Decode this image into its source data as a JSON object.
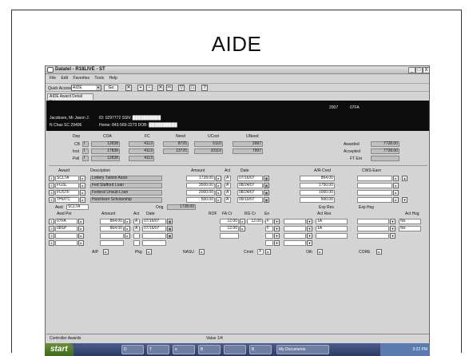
{
  "slide_title": "AIDE",
  "window": {
    "title": "Datatel - R18LIVE - ST",
    "controls": [
      "_",
      "□",
      "X"
    ]
  },
  "menu": [
    "File",
    "Edit",
    "Favorites",
    "Tools",
    "Help"
  ],
  "toolbar": {
    "quick_access_label": "Quick Access",
    "quick_access_value": "AIDE",
    "go_label": "Go"
  },
  "tab_label": "AIDE Award Detail Entry",
  "header": {
    "name": "Jacobsen, Mr Jason J.",
    "id": "ID: 0297772 SSN: ██████████",
    "location": "N Chas    SC   29406",
    "home": "Home: 843-569-2273  DOB: ██████████",
    "year": "2007",
    "term": "07FA"
  },
  "budget": {
    "headers": {
      "dep": "Dep",
      "coa": "COA",
      "fc": "FC",
      "need": "Need",
      "ucost": "UCost",
      "uneed": "UNeed"
    },
    "rows": [
      {
        "label": "CB",
        "flag": "I",
        "coa": "12838",
        "fc": "4113",
        "need": "8725",
        "ucost": "5110",
        "uneed": "2997"
      },
      {
        "label": "Inst",
        "flag": "I",
        "coa": "17838",
        "fc": "4113",
        "need": "13725",
        "ucost": "10110",
        "uneed": "7997"
      },
      {
        "label": "Pell",
        "flag": "I",
        "coa": "12838",
        "fc": "4113",
        "need": "",
        "ucost": "",
        "uneed": ""
      }
    ],
    "awarded_label": "Awarded",
    "awarded_value": "7728.00",
    "accepted_label": "Accepted",
    "accepted_value": "7728.00",
    "ftent_label": "FT Ent"
  },
  "awards": {
    "headers": {
      "award": "Award",
      "description": "Description",
      "amount": "Amount",
      "act": "Act",
      "date": "Date",
      "ar_cred": "A/R-Cred",
      "cws_earn": "CWS-Earn"
    },
    "rows": [
      {
        "num": "1",
        "code": "SCLTA",
        "description": "Lottery Tuition Assis",
        "amount": "1728.00",
        "act": "A",
        "date": "07/16/07",
        "ar_cred": "864.00"
      },
      {
        "num": "2",
        "code": "FGSL",
        "description": "Fed Stafford Loan",
        "amount": "3500.00",
        "act": "A",
        "date": "08/24/07",
        "ar_cred": "1750.00"
      },
      {
        "num": "3",
        "code": "FUSTF",
        "description": "Federal Unsub Loan",
        "amount": "2000.00",
        "act": "A",
        "date": "08/24/07",
        "ar_cred": "1000.00"
      },
      {
        "num": "4",
        "code": "THUTC",
        "description": "Hutchison Scholarship",
        "amount": "500.00",
        "act": "A",
        "date": "09/10/07",
        "ar_cred": "500.00"
      }
    ]
  },
  "award_detail": {
    "awd_label": "Awd",
    "awd_value": "SCLTA",
    "orig_label": "Orig",
    "orig_value": "1728.00",
    "headers": {
      "awd_per": "Awd Per",
      "amount": "Amount",
      "act": "Act",
      "date": "Date",
      "rof": "ROF",
      "fa_cr": "FA Cr",
      "rg_cr": "RG Cr",
      "en": "En",
      "exp_res": "Exp Res",
      "act_res": "Act Res",
      "exp_hsg": "Exp Hsg",
      "act_hsg": "Act Hsg"
    },
    "rows": [
      {
        "num": "1",
        "period": "07FA",
        "amount": "864.00",
        "act": "A",
        "date": "07/16/07",
        "fa_cr": "12.00",
        "rg_cr": "12.00",
        "en": "F",
        "act_res": "1A",
        "act_hsg": "No"
      },
      {
        "num": "2",
        "period": "08SP",
        "amount": "864.00",
        "act": "A",
        "date": "07/16/07",
        "fa_cr": "12.00",
        "rg_cr": "",
        "en": "F",
        "act_res": "1A",
        "act_hsg": "No"
      },
      {
        "num": "3",
        "period": "",
        "amount": "",
        "act": "",
        "date": "",
        "fa_cr": "",
        "rg_cr": "",
        "en": "",
        "act_res": "",
        "act_hsg": ""
      },
      {
        "num": "4",
        "period": "",
        "amount": "",
        "act": "",
        "date": "",
        "fa_cr": "",
        "rg_cr": "",
        "en": "",
        "act_res": "",
        "act_hsg": ""
      }
    ]
  },
  "footer_fields": {
    "aip": "AIP",
    "pkg": "Pkg",
    "nasu": "NASU",
    "cmnt": "Cmnt",
    "cmnt_mark": "X",
    "oth": "Oth",
    "core": "CORE"
  },
  "status": {
    "left": "Controller Awards",
    "value": "Value 1/4"
  },
  "taskbar": {
    "start": "start",
    "buttons": [
      "D",
      "T",
      "e",
      "B",
      "",
      "B",
      "My Documents"
    ],
    "clock": "3:22 PM"
  }
}
